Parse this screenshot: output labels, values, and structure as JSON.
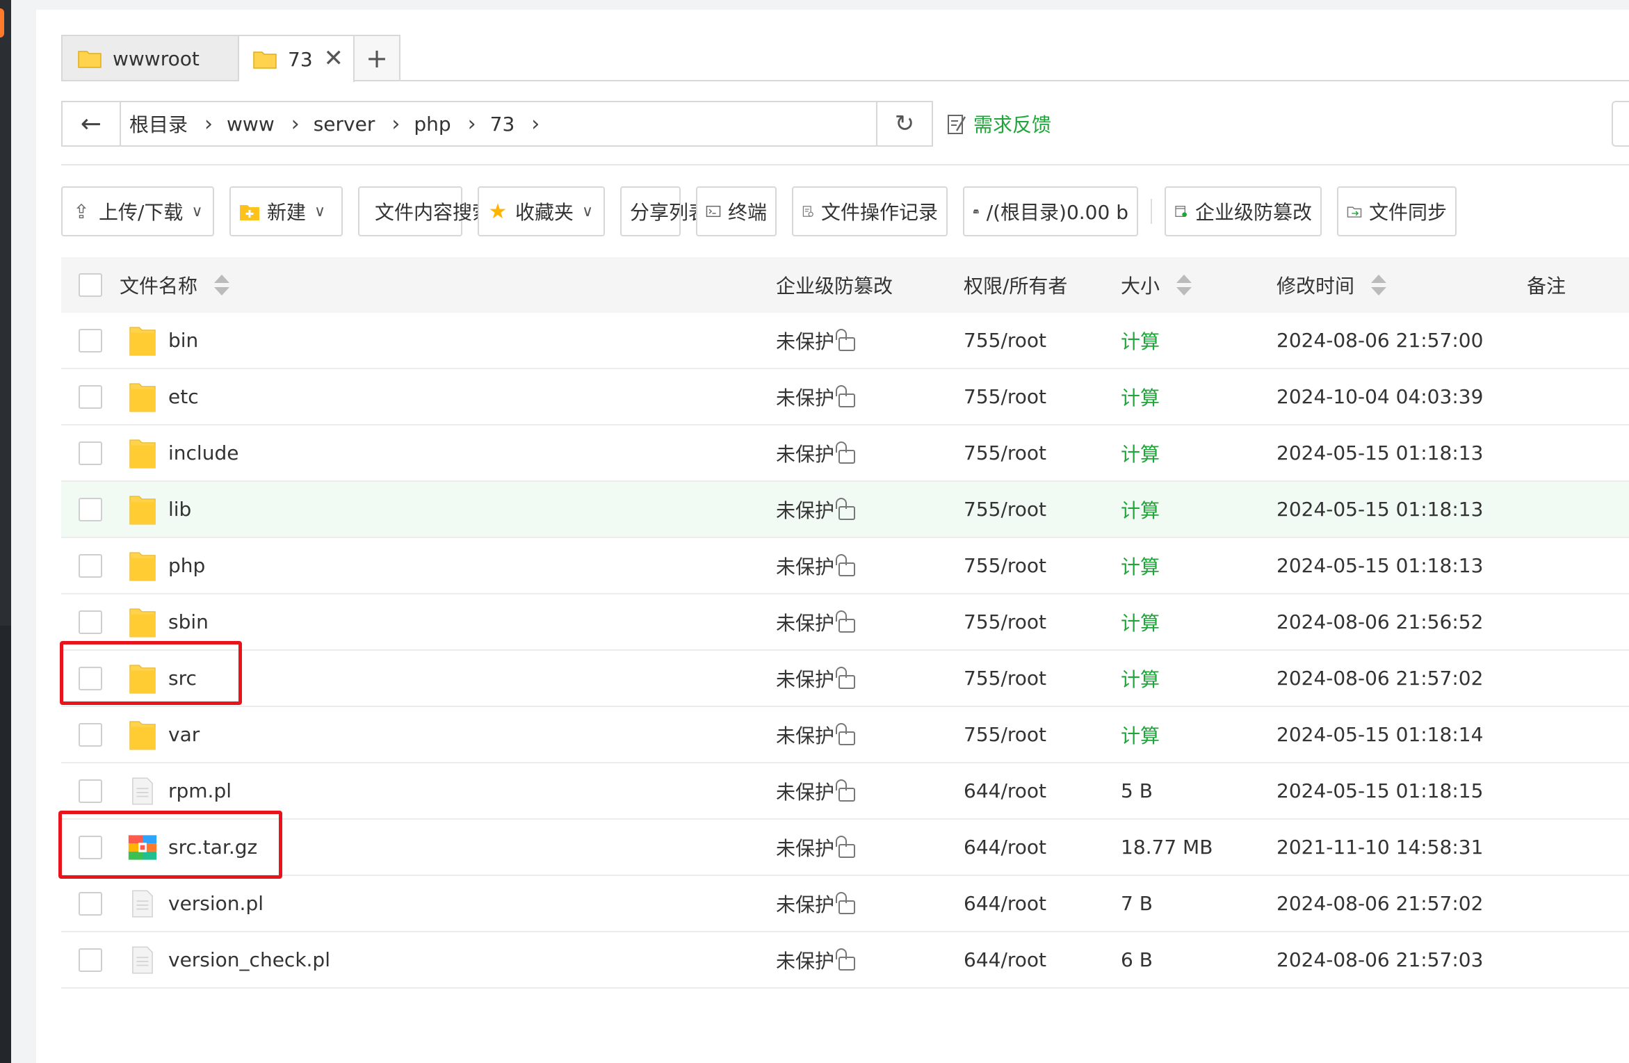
{
  "tabs": [
    {
      "label": "wwwroot",
      "active": false
    },
    {
      "label": "73",
      "active": true
    }
  ],
  "tab_close": "✕",
  "tab_add": "+",
  "path": {
    "back": "←",
    "crumbs": [
      "根目录",
      "www",
      "server",
      "php",
      "73"
    ],
    "separator": "›",
    "refresh": "↻"
  },
  "feedback_label": "需求反馈",
  "toolbar": {
    "upload_download": "上传/下载",
    "new": "新建",
    "content_search": "文件内容搜索",
    "favorites": "收藏夹",
    "share_list": "分享列表",
    "terminal": "终端",
    "operation_log": "文件操作记录",
    "disk": "/(根目录)0.00 b",
    "tamper_proof": "企业级防篡改",
    "file_sync": "文件同步"
  },
  "table": {
    "headers": {
      "name": "文件名称",
      "protection": "企业级防篡改",
      "perm_owner": "权限/所有者",
      "size": "大小",
      "mtime": "修改时间",
      "note": "备注"
    },
    "rows": [
      {
        "name": "bin",
        "type": "folder",
        "protection": "未保护",
        "perm": "755/root",
        "size": "计算",
        "mtime": "2024-08-06 21:57:00"
      },
      {
        "name": "etc",
        "type": "folder",
        "protection": "未保护",
        "perm": "755/root",
        "size": "计算",
        "mtime": "2024-10-04 04:03:39"
      },
      {
        "name": "include",
        "type": "folder",
        "protection": "未保护",
        "perm": "755/root",
        "size": "计算",
        "mtime": "2024-05-15 01:18:13"
      },
      {
        "name": "lib",
        "type": "folder",
        "protection": "未保护",
        "perm": "755/root",
        "size": "计算",
        "mtime": "2024-05-15 01:18:13"
      },
      {
        "name": "php",
        "type": "folder",
        "protection": "未保护",
        "perm": "755/root",
        "size": "计算",
        "mtime": "2024-05-15 01:18:13"
      },
      {
        "name": "sbin",
        "type": "folder",
        "protection": "未保护",
        "perm": "755/root",
        "size": "计算",
        "mtime": "2024-08-06 21:56:52"
      },
      {
        "name": "src",
        "type": "folder",
        "protection": "未保护",
        "perm": "755/root",
        "size": "计算",
        "mtime": "2024-08-06 21:57:02"
      },
      {
        "name": "var",
        "type": "folder",
        "protection": "未保护",
        "perm": "755/root",
        "size": "计算",
        "mtime": "2024-05-15 01:18:14"
      },
      {
        "name": "rpm.pl",
        "type": "file",
        "protection": "未保护",
        "perm": "644/root",
        "size": "5 B",
        "mtime": "2024-05-15 01:18:15"
      },
      {
        "name": "src.tar.gz",
        "type": "archive",
        "protection": "未保护",
        "perm": "644/root",
        "size": "18.77 MB",
        "mtime": "2021-11-10 14:58:31"
      },
      {
        "name": "version.pl",
        "type": "file",
        "protection": "未保护",
        "perm": "644/root",
        "size": "7 B",
        "mtime": "2024-08-06 21:57:02"
      },
      {
        "name": "version_check.pl",
        "type": "file",
        "protection": "未保护",
        "perm": "644/root",
        "size": "6 B",
        "mtime": "2024-08-06 21:57:03"
      }
    ]
  },
  "colors": {
    "accent_green": "#20a53a",
    "highlight_red": "#e8141c",
    "folder_yellow": "#ffd34d"
  }
}
